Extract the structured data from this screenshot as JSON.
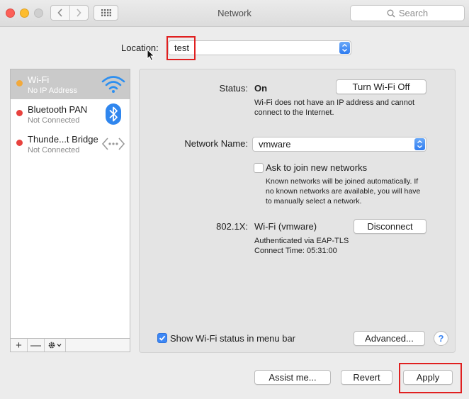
{
  "window": {
    "title": "Network"
  },
  "search": {
    "placeholder": "Search"
  },
  "location": {
    "label": "Location:",
    "value": "test"
  },
  "services": [
    {
      "name": "Wi-Fi",
      "status": "No IP Address",
      "dot_color": "#f2a93b",
      "icon": "wifi-icon",
      "selected": true
    },
    {
      "name": "Bluetooth PAN",
      "status": "Not Connected",
      "dot_color": "#e8423e",
      "icon": "bluetooth-icon",
      "selected": false
    },
    {
      "name": "Thunde...t Bridge",
      "status": "Not Connected",
      "dot_color": "#e8423e",
      "icon": "thunderbolt-bridge-icon",
      "selected": false
    }
  ],
  "sidebar_footer": {
    "add": "+",
    "remove": "—"
  },
  "detail": {
    "status_label": "Status:",
    "status_value": "On",
    "turn_off_button": "Turn Wi-Fi Off",
    "status_desc_line1": "Wi-Fi does not have an IP address and cannot",
    "status_desc_line2": "connect to the Internet.",
    "network_name_label": "Network Name:",
    "network_name_value": "vmware",
    "ask_join_label": "Ask to join new networks",
    "ask_join_checked": false,
    "ask_desc_line1": "Known networks will be joined automatically. If",
    "ask_desc_line2": "no known networks are available, you will have",
    "ask_desc_line3": "to manually select a network.",
    "dot1x_label": "802.1X:",
    "dot1x_value": "Wi-Fi (vmware)",
    "disconnect_button": "Disconnect",
    "auth_line": "Authenticated via EAP-TLS",
    "connect_time": "Connect Time: 05:31:00",
    "show_status_label": "Show Wi-Fi status in menu bar",
    "show_status_checked": true,
    "advanced_button": "Advanced...",
    "help_button": "?"
  },
  "bottom": {
    "assist_button": "Assist me...",
    "revert_button": "Revert",
    "apply_button": "Apply"
  },
  "colors": {
    "accent": "#3d87f5",
    "highlight_box": "#e02020"
  }
}
